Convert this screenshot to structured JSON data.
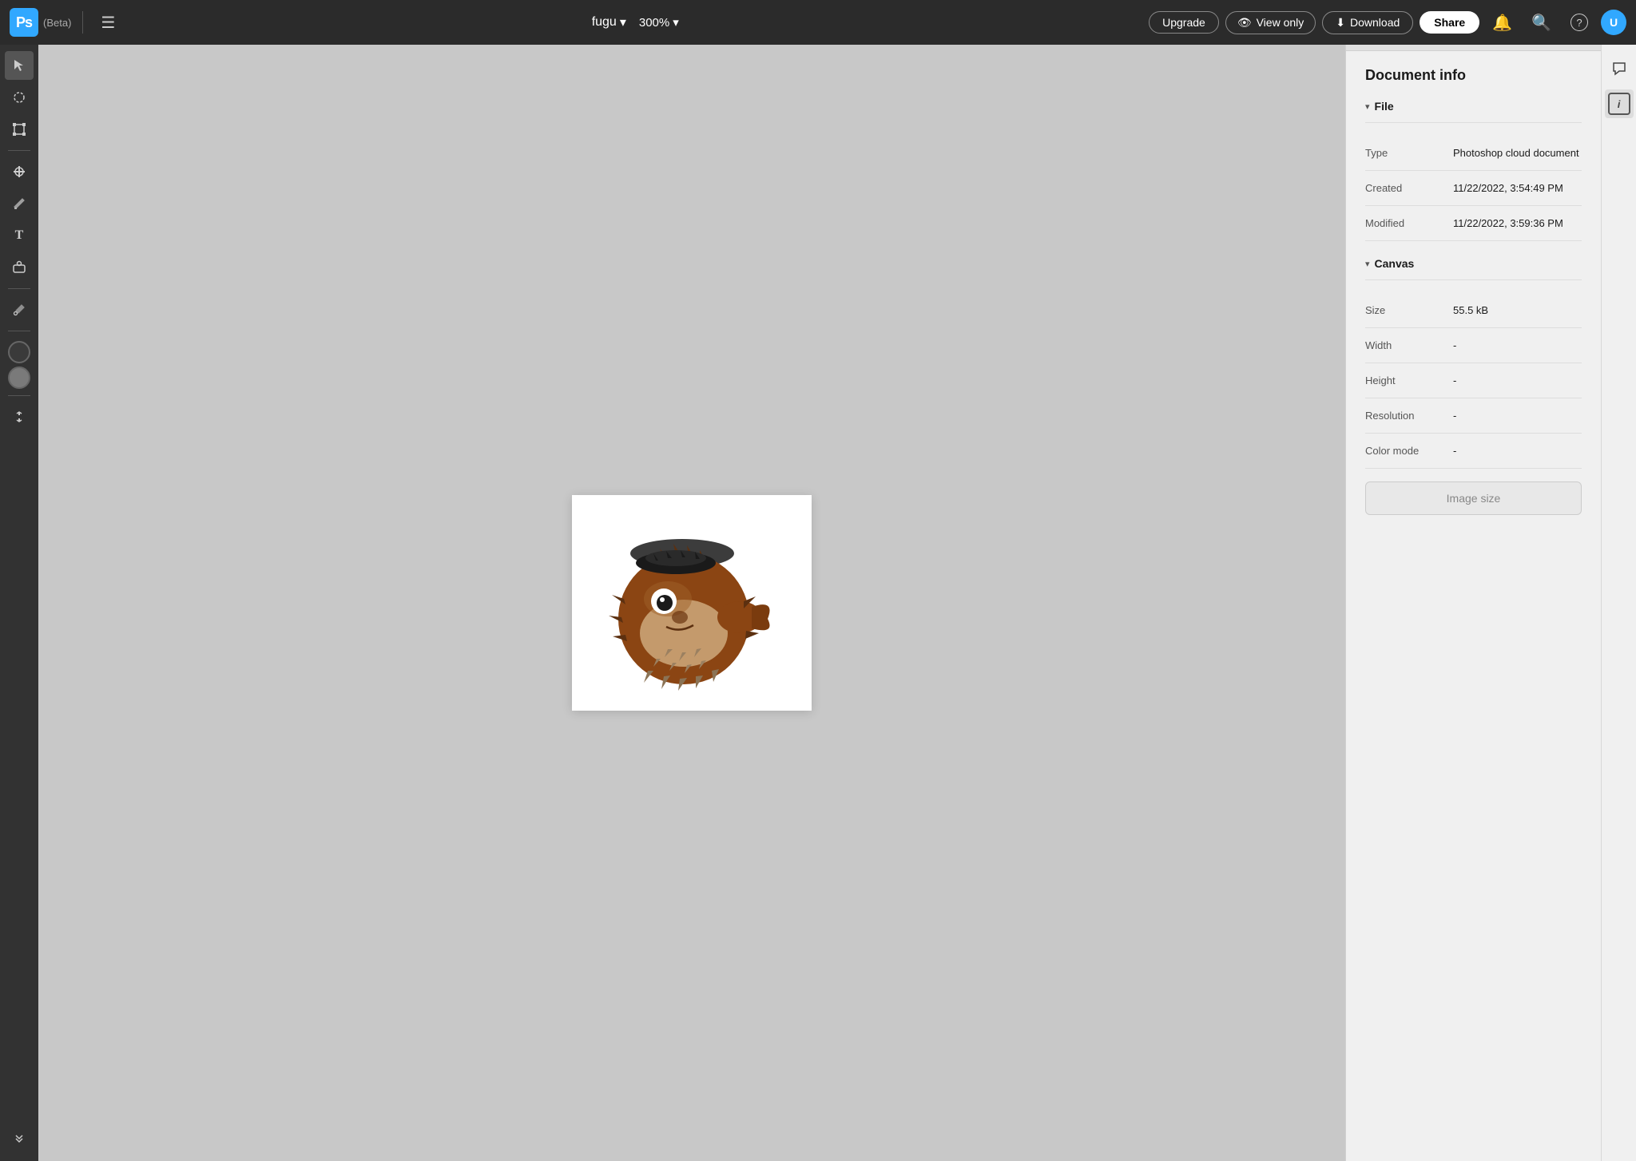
{
  "app": {
    "logo": "Ps",
    "beta": "(Beta)",
    "menu_icon": "☰"
  },
  "topbar": {
    "filename": "fugu",
    "zoom": "300%",
    "upgrade_label": "Upgrade",
    "view_only_label": "View only",
    "download_label": "Download",
    "share_label": "Share",
    "eye_icon": "👁",
    "download_icon": "⬇",
    "bell_icon": "🔔",
    "search_icon": "🔍",
    "help_icon": "?",
    "avatar_initial": "U"
  },
  "toolbar": {
    "tools": [
      {
        "name": "select",
        "icon": "↖",
        "label": "Select"
      },
      {
        "name": "lasso",
        "icon": "◌",
        "label": "Lasso"
      },
      {
        "name": "transform",
        "icon": "⊞",
        "label": "Transform"
      },
      {
        "name": "heal",
        "icon": "✦",
        "label": "Heal"
      },
      {
        "name": "brush",
        "icon": "✏",
        "label": "Brush"
      },
      {
        "name": "type",
        "icon": "T",
        "label": "Type"
      },
      {
        "name": "shape",
        "icon": "⊕",
        "label": "Shape"
      },
      {
        "name": "eyedropper",
        "icon": "⊘",
        "label": "Eyedropper"
      }
    ],
    "fg_color": "#3a3a3a",
    "bg_color": "#7a7a7a"
  },
  "right_panel": {
    "title": "Document info",
    "file_section": {
      "label": "File",
      "rows": [
        {
          "label": "Type",
          "value": "Photoshop cloud document"
        },
        {
          "label": "Created",
          "value": "11/22/2022, 3:54:49 PM"
        },
        {
          "label": "Modified",
          "value": "11/22/2022, 3:59:36 PM"
        }
      ]
    },
    "canvas_section": {
      "label": "Canvas",
      "rows": [
        {
          "label": "Size",
          "value": "55.5 kB"
        },
        {
          "label": "Width",
          "value": "-"
        },
        {
          "label": "Height",
          "value": "-"
        },
        {
          "label": "Resolution",
          "value": "-"
        },
        {
          "label": "Color mode",
          "value": "-"
        }
      ]
    },
    "image_size_btn": "Image size"
  }
}
